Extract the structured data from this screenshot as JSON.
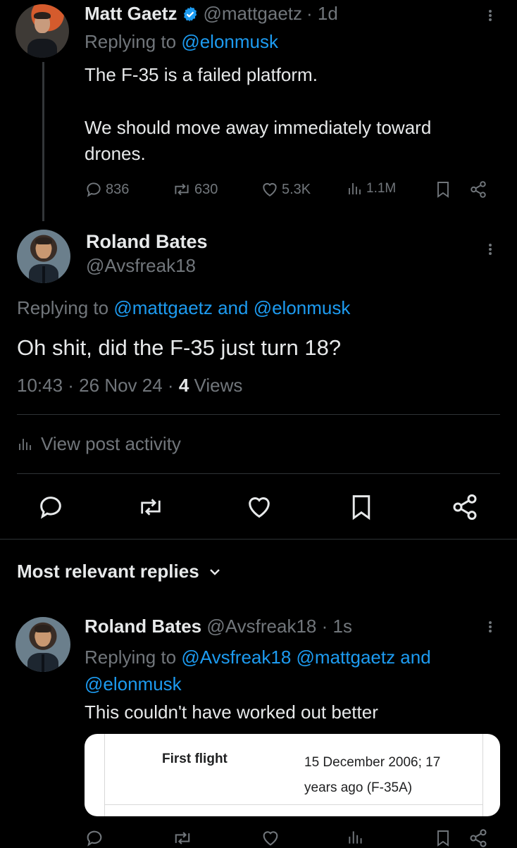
{
  "tweet1": {
    "name": "Matt Gaetz",
    "handle": "@mattgaetz",
    "time": "· 1d",
    "replying_prefix": "Replying to",
    "replying_to": "@elonmusk",
    "text_line1": "The F-35 is a failed platform.",
    "text_line2": "We should move away immediately toward",
    "text_line3": "drones.",
    "replies": "836",
    "reposts": "630",
    "likes": "5.3K",
    "views": "1.1M"
  },
  "main_post": {
    "name": "Roland Bates",
    "handle": "@Avsfreak18",
    "replying_prefix": "Replying to",
    "replying_to": "@mattgaetz and @elonmusk",
    "text": "Oh shit, did the F-35 just turn 18?",
    "timestamp": "10:43 · 26 Nov 24 · ",
    "views_count": "4",
    "views_label": " Views",
    "activity_label": "View post activity"
  },
  "replies_header": {
    "label": "Most relevant replies"
  },
  "reply": {
    "name": "Roland Bates",
    "handle": "@Avsfreak18",
    "time": "· 1s",
    "replying_prefix": "Replying to",
    "replying_line1": "@Avsfreak18 @mattgaetz and",
    "replying_line2": "@elonmusk",
    "text": "This couldn't have worked out better",
    "card": {
      "label": "First flight",
      "value_line1": "15 December 2006; 17",
      "value_line2": "years ago (F-35A)"
    }
  },
  "colors": {
    "background": "#000000",
    "text": "#e7e9ea",
    "muted": "#71767b",
    "accent": "#1d9bf0",
    "verified": "#1d9bf0"
  },
  "icons": [
    "verified-badge-icon",
    "more-icon",
    "reply-icon",
    "repost-icon",
    "like-icon",
    "views-icon",
    "bookmark-icon",
    "share-icon",
    "chevron-down-icon"
  ]
}
